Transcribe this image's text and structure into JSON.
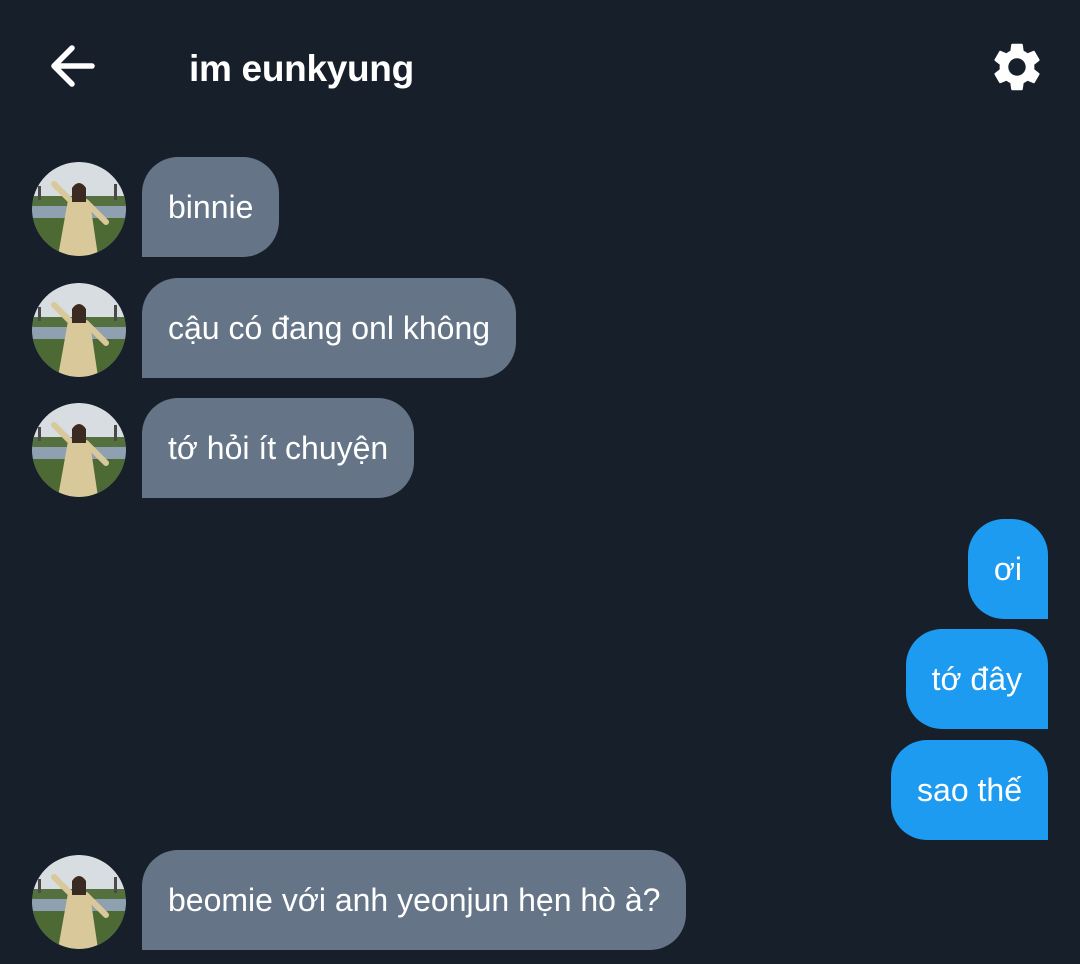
{
  "header": {
    "back_icon": "arrow-left-icon",
    "title": "im eunkyung",
    "settings_icon": "gear-icon"
  },
  "colors": {
    "background": "#171f2a",
    "incoming_bubble": "#657587",
    "outgoing_bubble": "#1d9bf0"
  },
  "messages": [
    {
      "from": "them",
      "text": "binnie"
    },
    {
      "from": "them",
      "text": "cậu có đang onl không"
    },
    {
      "from": "them",
      "text": "tớ hỏi ít chuyện"
    },
    {
      "from": "me",
      "text": "ơi"
    },
    {
      "from": "me",
      "text": "tớ đây"
    },
    {
      "from": "me",
      "text": "sao thế"
    },
    {
      "from": "them",
      "text": "beomie với anh yeonjun hẹn hò à?"
    }
  ]
}
